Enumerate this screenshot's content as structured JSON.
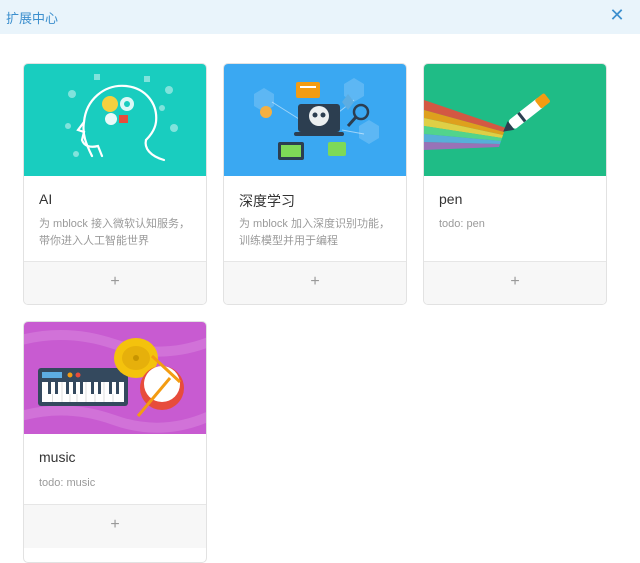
{
  "dialog": {
    "title": "扩展中心",
    "close_glyph": "✕"
  },
  "colors": {
    "titlebar_bg": "#e9f4fb",
    "accent": "#3c8fce",
    "ai_bg": "#19cdbf",
    "deep_bg": "#3aa8f2",
    "pen_bg": "#1fbc86",
    "music_bg": "#c85bd1"
  },
  "extensions": [
    {
      "name": "AI",
      "description": "为 mblock 接入微软认知服务，带你进入人工智能世界",
      "add_glyph": "+",
      "icon": "brain-gears-icon"
    },
    {
      "name": "深度学习",
      "description": "为 mblock 加入深度识别功能，训练模型并用于编程",
      "add_glyph": "+",
      "icon": "robot-laptop-icon"
    },
    {
      "name": "pen",
      "description": "todo: pen",
      "add_glyph": "+",
      "icon": "pen-rainbow-icon"
    },
    {
      "name": "music",
      "description": "todo: music",
      "add_glyph": "+",
      "icon": "keyboard-drum-icon"
    }
  ]
}
